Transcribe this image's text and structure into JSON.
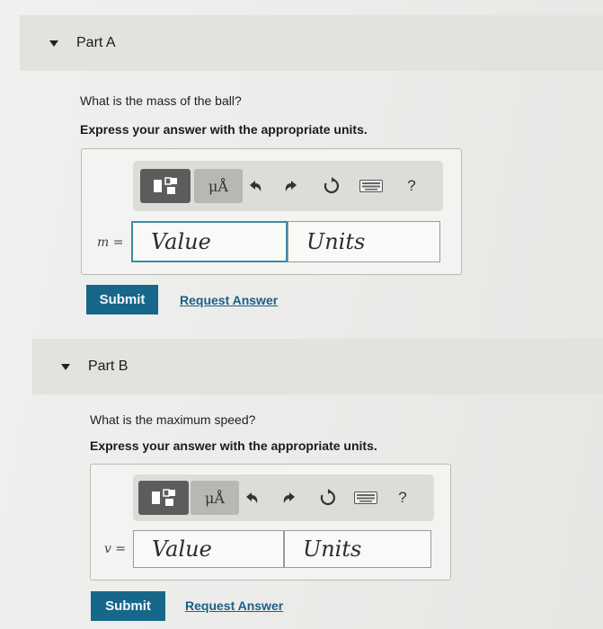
{
  "part_a": {
    "title": "Part A",
    "question": "What is the mass of the ball?",
    "instruction": "Express your answer with the appropriate units.",
    "toolbar": {
      "units_symbol": "μÅ",
      "help": "?"
    },
    "variable_label": "m =",
    "value_placeholder": "Value",
    "units_placeholder": "Units",
    "submit_label": "Submit",
    "request_label": "Request Answer"
  },
  "part_b": {
    "title": "Part B",
    "question": "What is the maximum speed?",
    "instruction": "Express your answer with the appropriate units.",
    "toolbar": {
      "units_symbol": "μÅ",
      "help": "?"
    },
    "variable_label": "v =",
    "value_placeholder": "Value",
    "units_placeholder": "Units",
    "submit_label": "Submit",
    "request_label": "Request Answer"
  },
  "colors": {
    "submit_bg": "#17678a",
    "link": "#1c5f86",
    "value_border": "#3d8aa6"
  },
  "icons": [
    "caret-down-icon",
    "templates-icon",
    "units-icon",
    "undo-icon",
    "redo-icon",
    "reset-icon",
    "keyboard-icon",
    "help-icon"
  ]
}
